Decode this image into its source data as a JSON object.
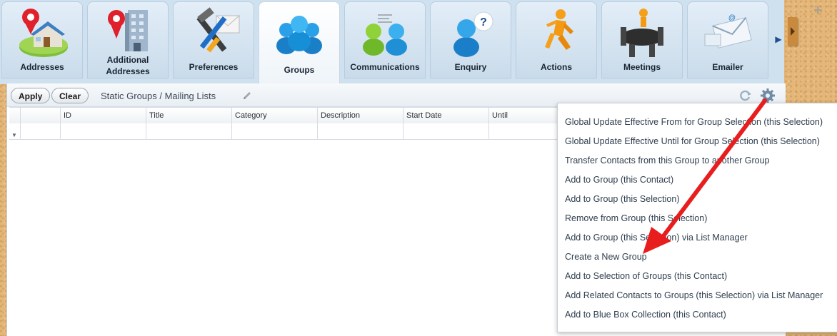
{
  "tabs": [
    {
      "label": "Addresses",
      "icon": "house-pin-icon"
    },
    {
      "label": "Additional Addresses",
      "icon": "building-pin-icon"
    },
    {
      "label": "Preferences",
      "icon": "tools-icon"
    },
    {
      "label": "Groups",
      "icon": "group-people-icon",
      "active": true
    },
    {
      "label": "Communications",
      "icon": "communications-people-icon"
    },
    {
      "label": "Enquiry",
      "icon": "enquiry-person-icon"
    },
    {
      "label": "Actions",
      "icon": "running-man-icon"
    },
    {
      "label": "Meetings",
      "icon": "meeting-table-icon"
    },
    {
      "label": "Emailer",
      "icon": "envelope-icon"
    }
  ],
  "toolbar": {
    "apply_label": "Apply",
    "clear_label": "Clear",
    "title": "Static Groups / Mailing Lists"
  },
  "grid": {
    "columns": [
      "",
      "ID",
      "Title",
      "Category",
      "Description",
      "Start Date",
      "Until"
    ]
  },
  "menu": {
    "items": [
      "Global Update Effective From for Group Selection (this Selection)",
      "Global Update Effective Until for Group Selection (this Selection)",
      "Transfer Contacts from this Group to another Group",
      "Add to Group (this Contact)",
      "Add to Group (this Selection)",
      "Remove from Group (this Selection)",
      "Add to Group (this Selection) via List Manager",
      "Create a New Group",
      "Add to Selection of Groups (this Contact)",
      "Add Related Contacts to Groups (this Selection) via List Manager",
      "Add to Blue Box Collection (this Contact)"
    ]
  },
  "colors": {
    "accent_arrow": "#e81e1e",
    "tab_bg": "#d6e6f3",
    "cork": "#e4b677"
  }
}
